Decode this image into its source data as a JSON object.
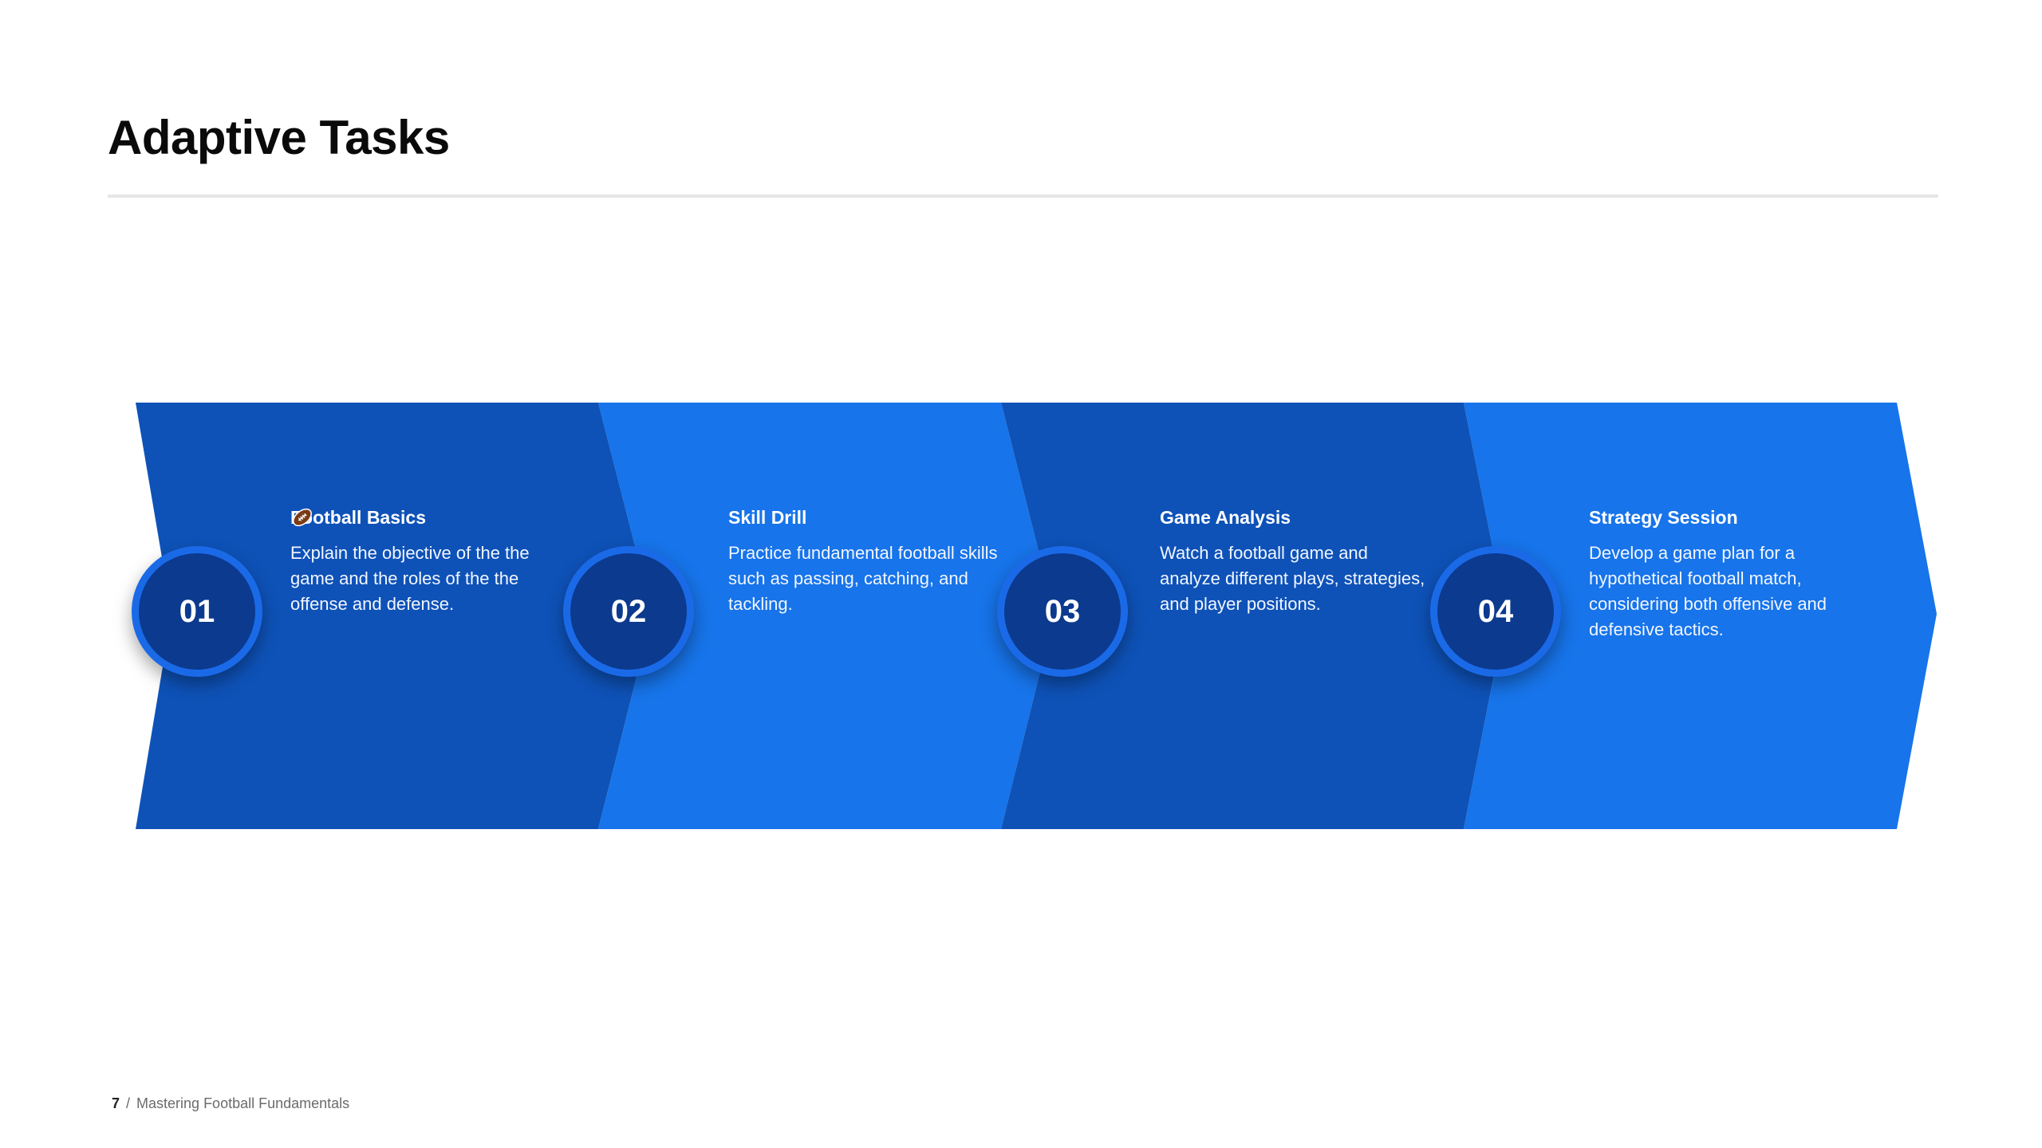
{
  "slide": {
    "title": "Adaptive Tasks"
  },
  "colors": {
    "dark_segment": "#0e52b8",
    "light_segment": "#1774ea",
    "circle_fill": "#0c3a8e",
    "circle_ring": "#1a6ae8"
  },
  "steps": [
    {
      "number": "01",
      "title": "Football Basics",
      "icon": "football-icon",
      "description": "Explain the objective of the the game and the roles of the the offense and defense."
    },
    {
      "number": "02",
      "title": "Skill Drill",
      "description": "Practice fundamental football skills such as passing, catching, and tackling."
    },
    {
      "number": "03",
      "title": "Game Analysis",
      "description": "Watch a football game and analyze different plays, strategies, and player positions."
    },
    {
      "number": "04",
      "title": "Strategy Session",
      "description": "Develop a game plan for a hypothetical football match, considering both offensive and defensive tactics."
    }
  ],
  "footer": {
    "page_number": "7",
    "separator": "/",
    "deck_title": "Mastering Football Fundamentals"
  }
}
